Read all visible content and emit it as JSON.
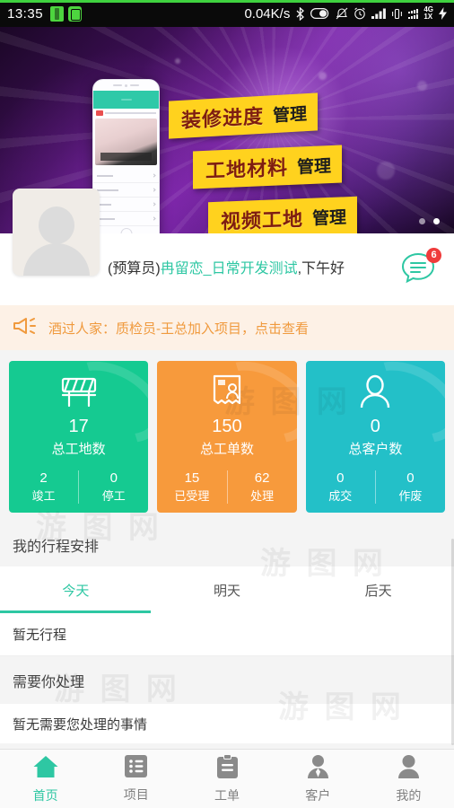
{
  "statusbar": {
    "time": "13:35",
    "network_speed": "0.04K/s",
    "net_label_top": "4G",
    "net_label_bottom": "1X",
    "icons": [
      "battery-saver-icon",
      "app-icon",
      "bluetooth-icon",
      "battery-icon",
      "mute-icon",
      "alarm-icon",
      "signal-icon",
      "vibrate-icon",
      "sim-signal-icon",
      "charging-bolt-icon"
    ]
  },
  "banner": {
    "slogans": [
      {
        "big": "装修进度",
        "small": "管理"
      },
      {
        "big": "工地材料",
        "small": "管理"
      },
      {
        "big": "视频工地",
        "small": "管理"
      }
    ],
    "dots_total": 2,
    "dots_active_index": 1
  },
  "profile": {
    "role": "(预算员)",
    "name": "冉留恋_日常开发测试",
    "greeting_suffix": ",下午好",
    "avatar_alt": "用户头像",
    "chat_badge": "6",
    "name_color": "#2ec7a3"
  },
  "notice": {
    "icon": "megaphone-icon",
    "text": "酒过人家：质检员-王总加入项目，点击查看",
    "color": "#f09a3e"
  },
  "cards": [
    {
      "icon": "construction-barrier-icon",
      "value": "17",
      "label": "总工地数",
      "color": "#15ca91",
      "sub": [
        {
          "value": "2",
          "label": "竣工"
        },
        {
          "value": "0",
          "label": "停工"
        }
      ]
    },
    {
      "icon": "work-order-icon",
      "value": "150",
      "label": "总工单数",
      "color": "#f79a3c",
      "sub": [
        {
          "value": "15",
          "label": "已受理"
        },
        {
          "value": "62",
          "label": "处理"
        }
      ]
    },
    {
      "icon": "customer-person-icon",
      "value": "0",
      "label": "总客户数",
      "color": "#23c0c8",
      "sub": [
        {
          "value": "0",
          "label": "成交"
        },
        {
          "value": "0",
          "label": "作废"
        }
      ]
    }
  ],
  "schedule": {
    "section_title": "我的行程安排",
    "tabs": [
      {
        "label": "今天",
        "active": true
      },
      {
        "label": "明天",
        "active": false
      },
      {
        "label": "后天",
        "active": false
      }
    ],
    "empty_text": "暂无行程"
  },
  "todo": {
    "section_title": "需要你处理",
    "empty_text": "暂无需要您处理的事情"
  },
  "tabbar": [
    {
      "icon": "home-icon",
      "label": "首页",
      "active": true
    },
    {
      "icon": "list-icon",
      "label": "项目",
      "active": false
    },
    {
      "icon": "clipboard-icon",
      "label": "工单",
      "active": false
    },
    {
      "icon": "customer-icon",
      "label": "客户",
      "active": false
    },
    {
      "icon": "person-icon",
      "label": "我的",
      "active": false
    }
  ],
  "watermark": "游 图 网",
  "theme": {
    "accent": "#2ec7a3",
    "badge": "#ef3b3b",
    "notice_bg": "#fdf1e6"
  }
}
